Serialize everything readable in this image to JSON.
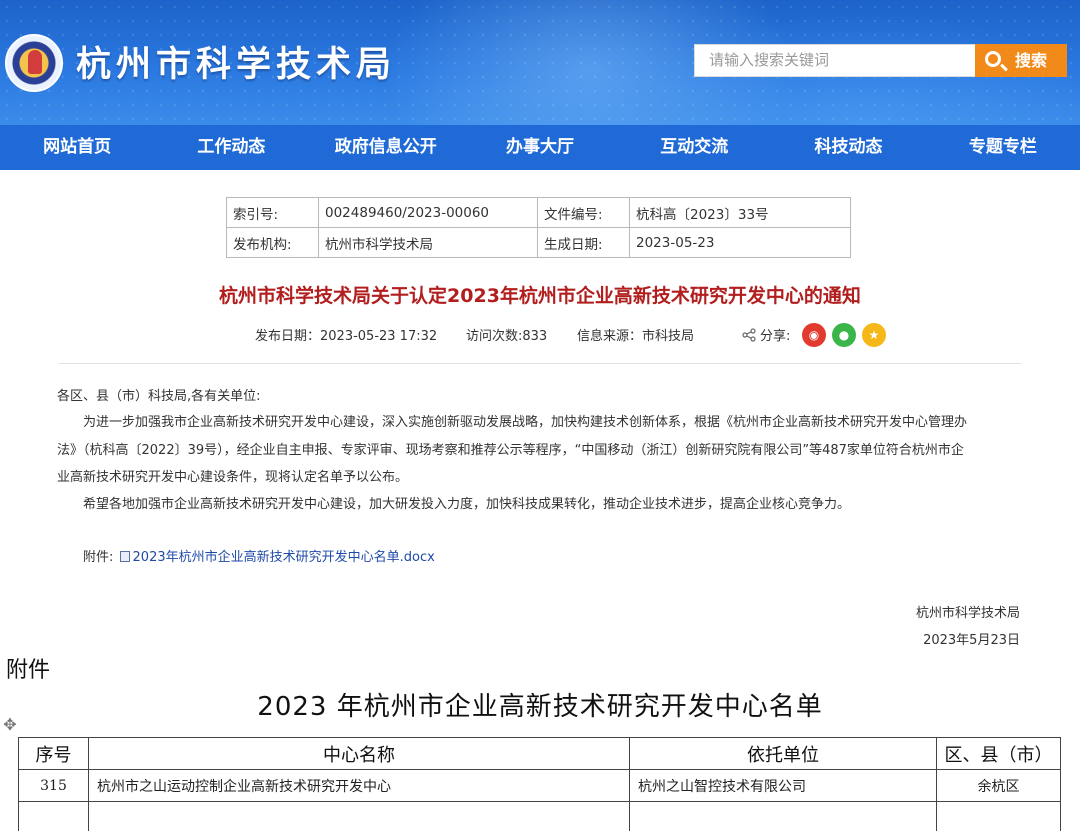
{
  "header": {
    "site_title": "杭州市科学技术局",
    "search_placeholder": "请输入搜索关键词",
    "search_button": "搜索"
  },
  "nav": [
    "网站首页",
    "工作动态",
    "政府信息公开",
    "办事大厅",
    "互动交流",
    "科技动态",
    "专题专栏"
  ],
  "meta": {
    "index_label": "索引号:",
    "index_value": "002489460/2023-00060",
    "docno_label": "文件编号:",
    "docno_value": "杭科高〔2023〕33号",
    "issuer_label": "发布机构:",
    "issuer_value": "杭州市科学技术局",
    "created_label": "生成日期:",
    "created_value": "2023-05-23"
  },
  "article": {
    "title": "杭州市科学技术局关于认定2023年杭州市企业高新技术研究开发中心的通知",
    "publish": "发布日期：2023-05-23 17:32",
    "visits": "访问次数:833",
    "source": "信息来源：市科技局",
    "share": "分享:",
    "greeting": "各区、县（市）科技局,各有关单位:",
    "para1_l1": "为进一步加强我市企业高新技术研究开发中心建设，深入实施创新驱动发展战略，加快构建技术创新体系，根据《杭州市企业高新技术研究开发中心管理办",
    "para1_l2": "法》（杭科高〔2022〕39号），经企业自主申报、专家评审、现场考察和推荐公示等程序，“中国移动（浙江）创新研究院有限公司”等487家单位符合杭州市企",
    "para1_l3": "业高新技术研究开发中心建设条件，现将认定名单予以公布。",
    "para2": "希望各地加强市企业高新技术研究开发中心建设，加大研发投入力度，加快科技成果转化，推动企业技术进步，提高企业核心竞争力。",
    "attach_label": "附件:",
    "attach_link": "2023年杭州市企业高新技术研究开发中心名单.docx",
    "sign_org": "杭州市科学技术局",
    "sign_date": "2023年5月23日"
  },
  "annex": {
    "label": "附件",
    "title": "2023 年杭州市企业高新技术研究开发中心名单",
    "headers": [
      "序号",
      "中心名称",
      "依托单位",
      "区、县（市）"
    ],
    "rows": [
      [
        "315",
        "杭州市之山运动控制企业高新技术研究开发中心",
        "杭州之山智控技术有限公司",
        "余杭区"
      ]
    ]
  },
  "colors": {
    "nav_bg": "#1f6ad6",
    "title_red": "#b21d1d",
    "search_orange": "#f28a1a",
    "link_blue": "#1f4aa8"
  }
}
